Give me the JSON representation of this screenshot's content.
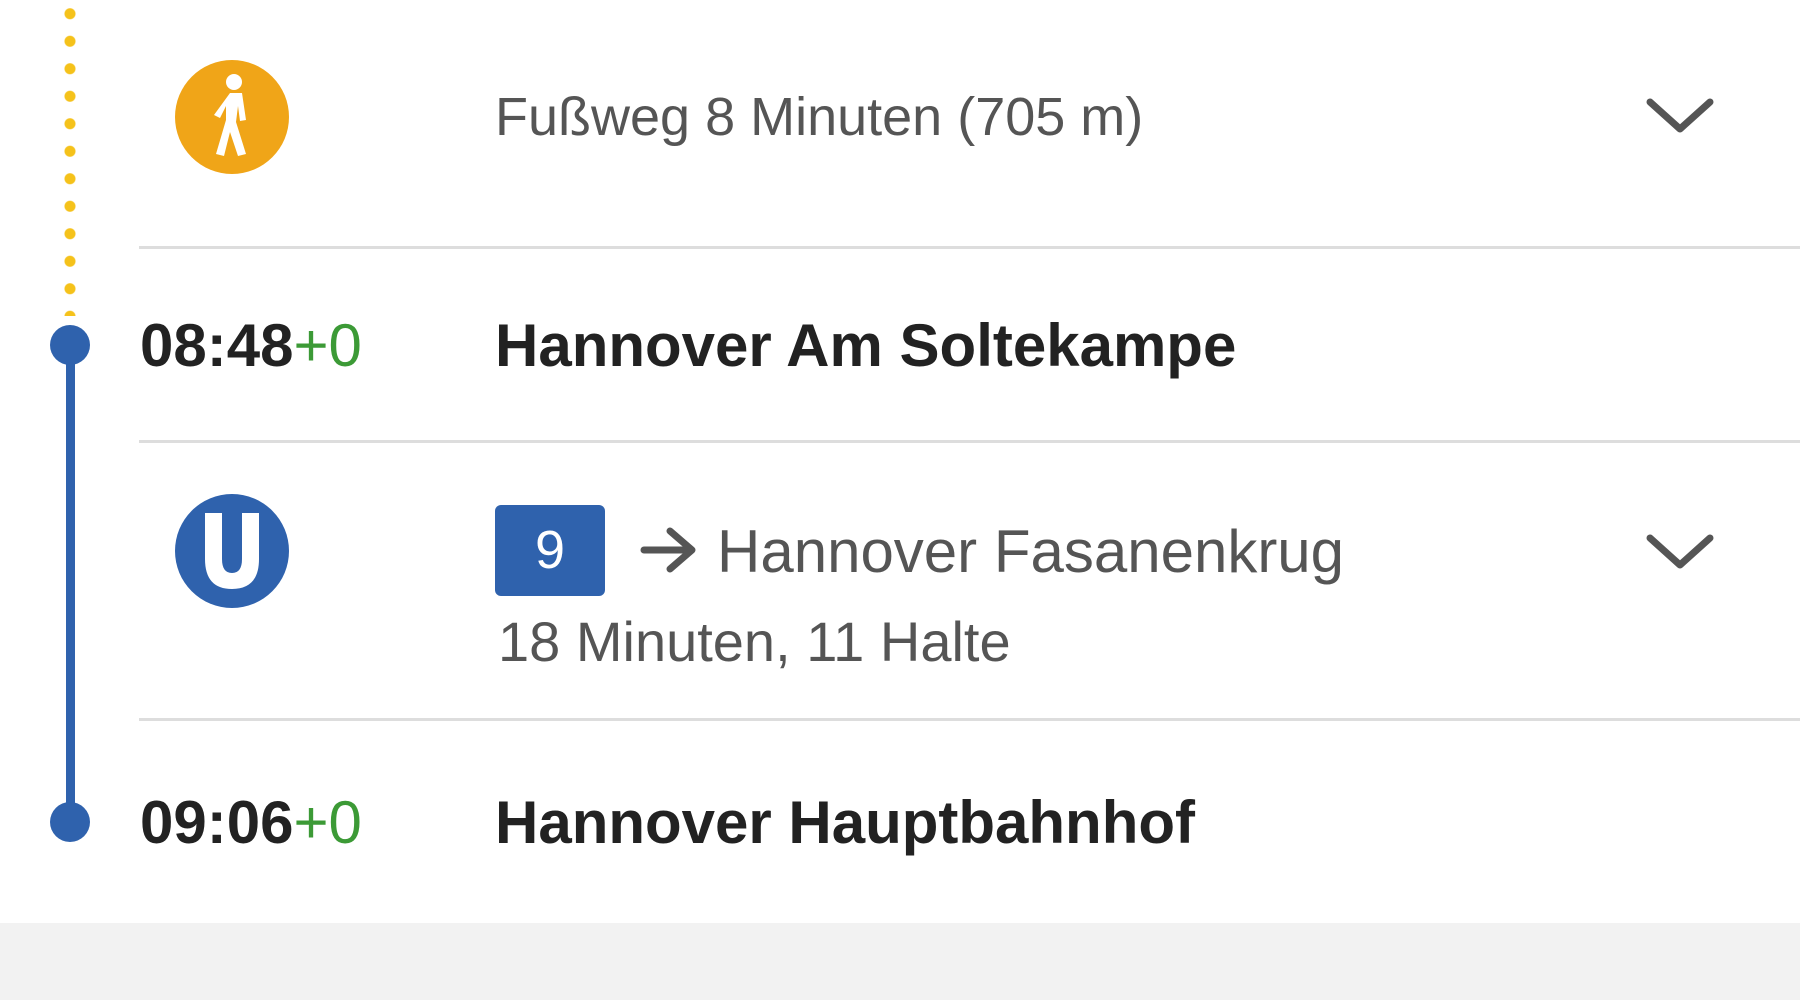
{
  "walk_leg": {
    "icon": "pedestrian-icon",
    "icon_color": "#f0a518",
    "text": "Fußweg 8 Minuten (705 m)"
  },
  "stops": [
    {
      "time": "08:48",
      "delay": "+0",
      "name": "Hannover Am Soltekampe"
    },
    {
      "time": "09:06",
      "delay": "+0",
      "name": "Hannover Hauptbahnhof"
    }
  ],
  "transit_leg": {
    "icon": "u-bahn-icon",
    "icon_letter": "U",
    "line": "9",
    "direction": "Hannover Fasanenkrug",
    "duration": "18 Minuten, 11 Halte"
  },
  "colors": {
    "transit_blue": "#2f62ad",
    "walk_orange": "#f0a518",
    "walk_dots_yellow": "#f5c21b",
    "delay_green": "#3c9a36"
  }
}
